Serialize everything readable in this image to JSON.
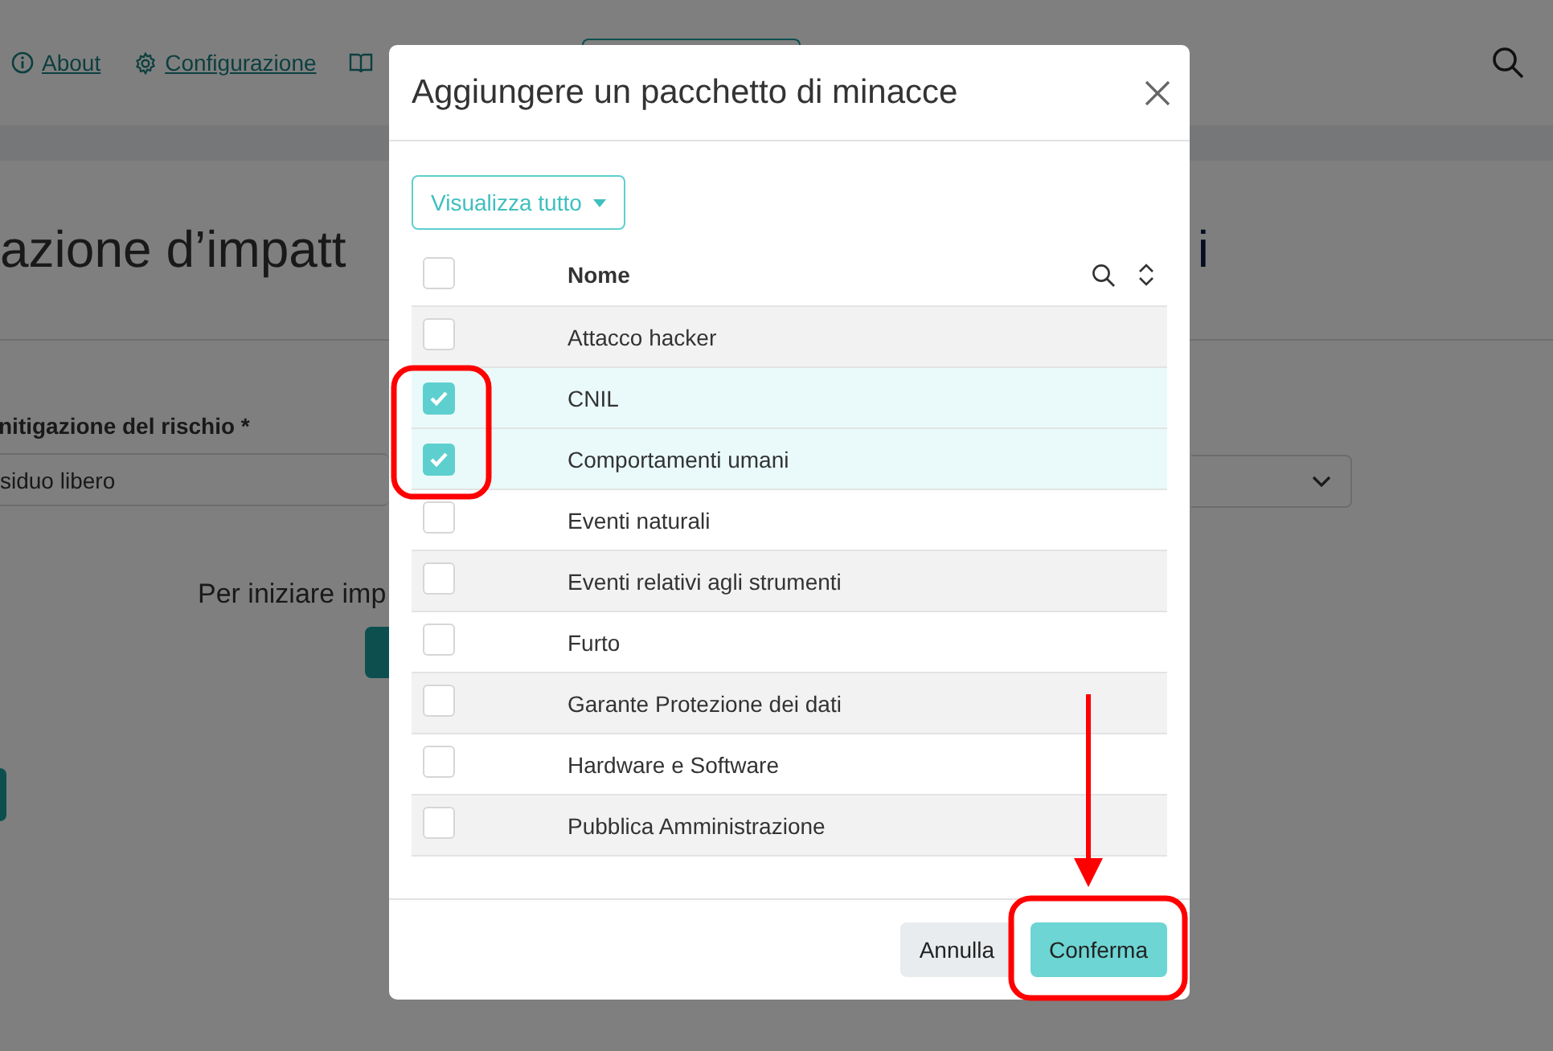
{
  "nav": {
    "links": [
      {
        "kind": "info",
        "label": "About"
      },
      {
        "kind": "gear",
        "label": "Configurazione"
      },
      {
        "kind": "book"
      }
    ]
  },
  "page": {
    "heading_left": "azione d’impatt",
    "heading_right": "i",
    "field_label": "nitigazione del rischio *",
    "field_value": "siduo libero",
    "hint": "Per iniziare imp"
  },
  "modal": {
    "title": "Aggiungere un pacchetto di minacce",
    "filter_button": "Visualizza tutto",
    "table": {
      "column": "Nome",
      "all_checked": false,
      "rows": [
        {
          "name": "Attacco hacker",
          "checked": false
        },
        {
          "name": "CNIL",
          "checked": true
        },
        {
          "name": "Comportamenti umani",
          "checked": true
        },
        {
          "name": "Eventi naturali",
          "checked": false
        },
        {
          "name": "Eventi relativi agli strumenti",
          "checked": false
        },
        {
          "name": "Furto",
          "checked": false
        },
        {
          "name": "Garante Protezione dei dati",
          "checked": false
        },
        {
          "name": "Hardware e Software",
          "checked": false
        },
        {
          "name": "Pubblica Amministrazione",
          "checked": false
        }
      ]
    },
    "buttons": [
      {
        "kind": "secondary",
        "label": "Annulla"
      },
      {
        "kind": "primary",
        "label": "Conferma"
      }
    ]
  },
  "annotations": [
    {
      "kind": "box"
    },
    {
      "kind": "arrow"
    },
    {
      "kind": "box"
    }
  ]
}
